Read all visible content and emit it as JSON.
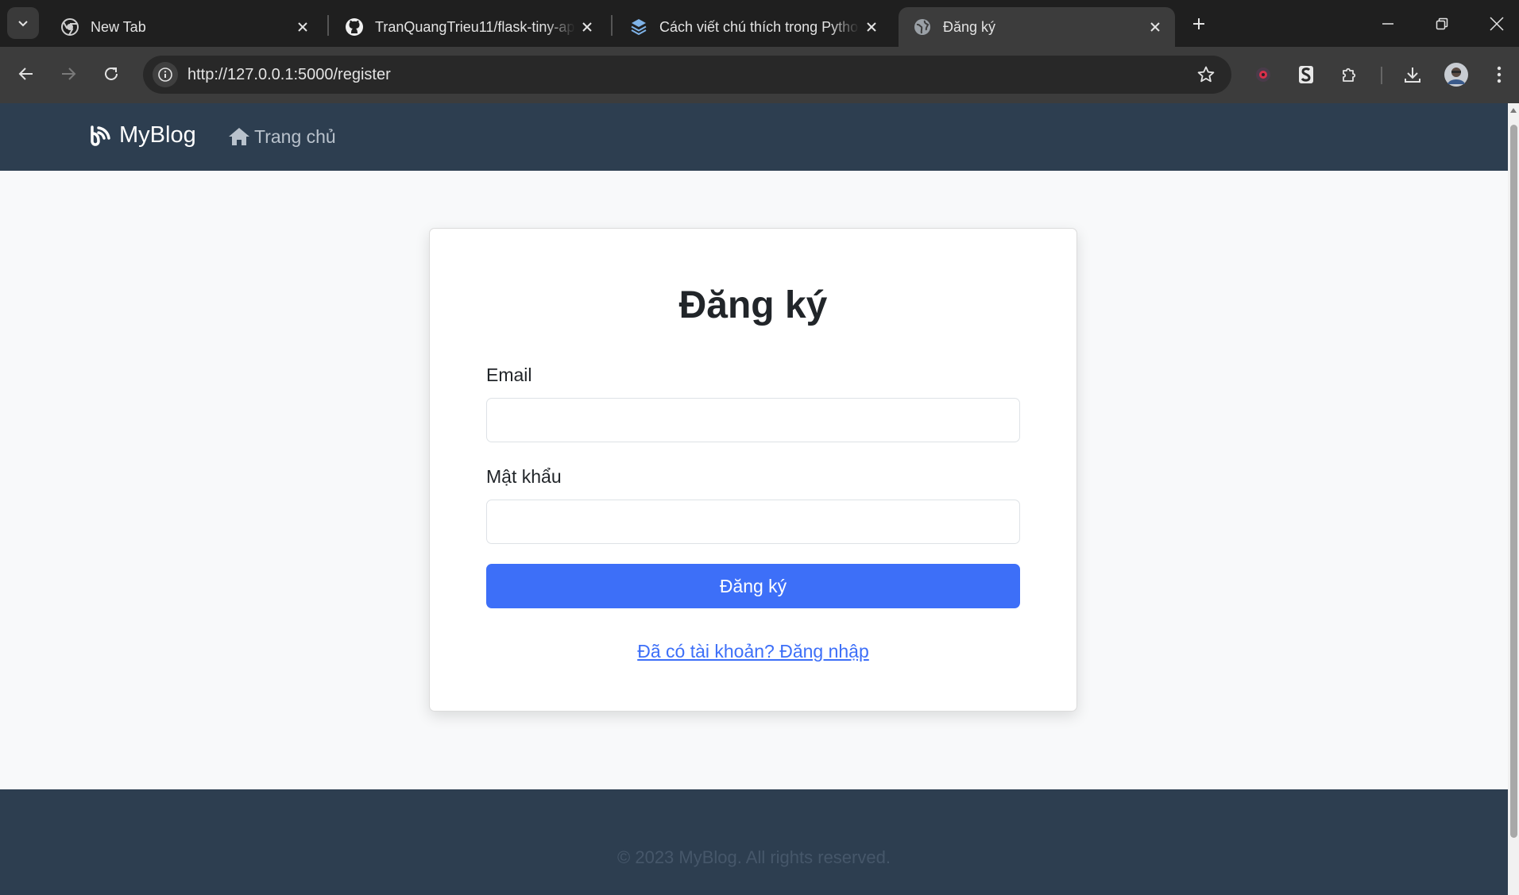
{
  "browser": {
    "tabs": [
      {
        "title": "New Tab",
        "icon": "chrome-icon",
        "active": false
      },
      {
        "title": "TranQuangTrieu11/flask-tiny-ap",
        "icon": "github-icon",
        "active": false
      },
      {
        "title": "Cách viết chú thích trong Pytho",
        "icon": "layers-icon",
        "active": false
      },
      {
        "title": "Đăng ký",
        "icon": "globe-icon",
        "active": true
      }
    ],
    "url": "http://127.0.0.1:5000/register"
  },
  "site": {
    "brand": "MyBlog",
    "nav": {
      "home": "Trang chủ"
    }
  },
  "register": {
    "title": "Đăng ký",
    "email_label": "Email",
    "email_value": "",
    "password_label": "Mật khẩu",
    "password_value": "",
    "submit_label": "Đăng ký",
    "login_link": "Đã có tài khoản? Đăng nhập"
  },
  "footer": {
    "copyright": "© 2023 MyBlog. All rights reserved."
  },
  "colors": {
    "navbar": "#2d3e50",
    "primary": "#3d6ff8",
    "page_bg": "#f8f9fa"
  }
}
